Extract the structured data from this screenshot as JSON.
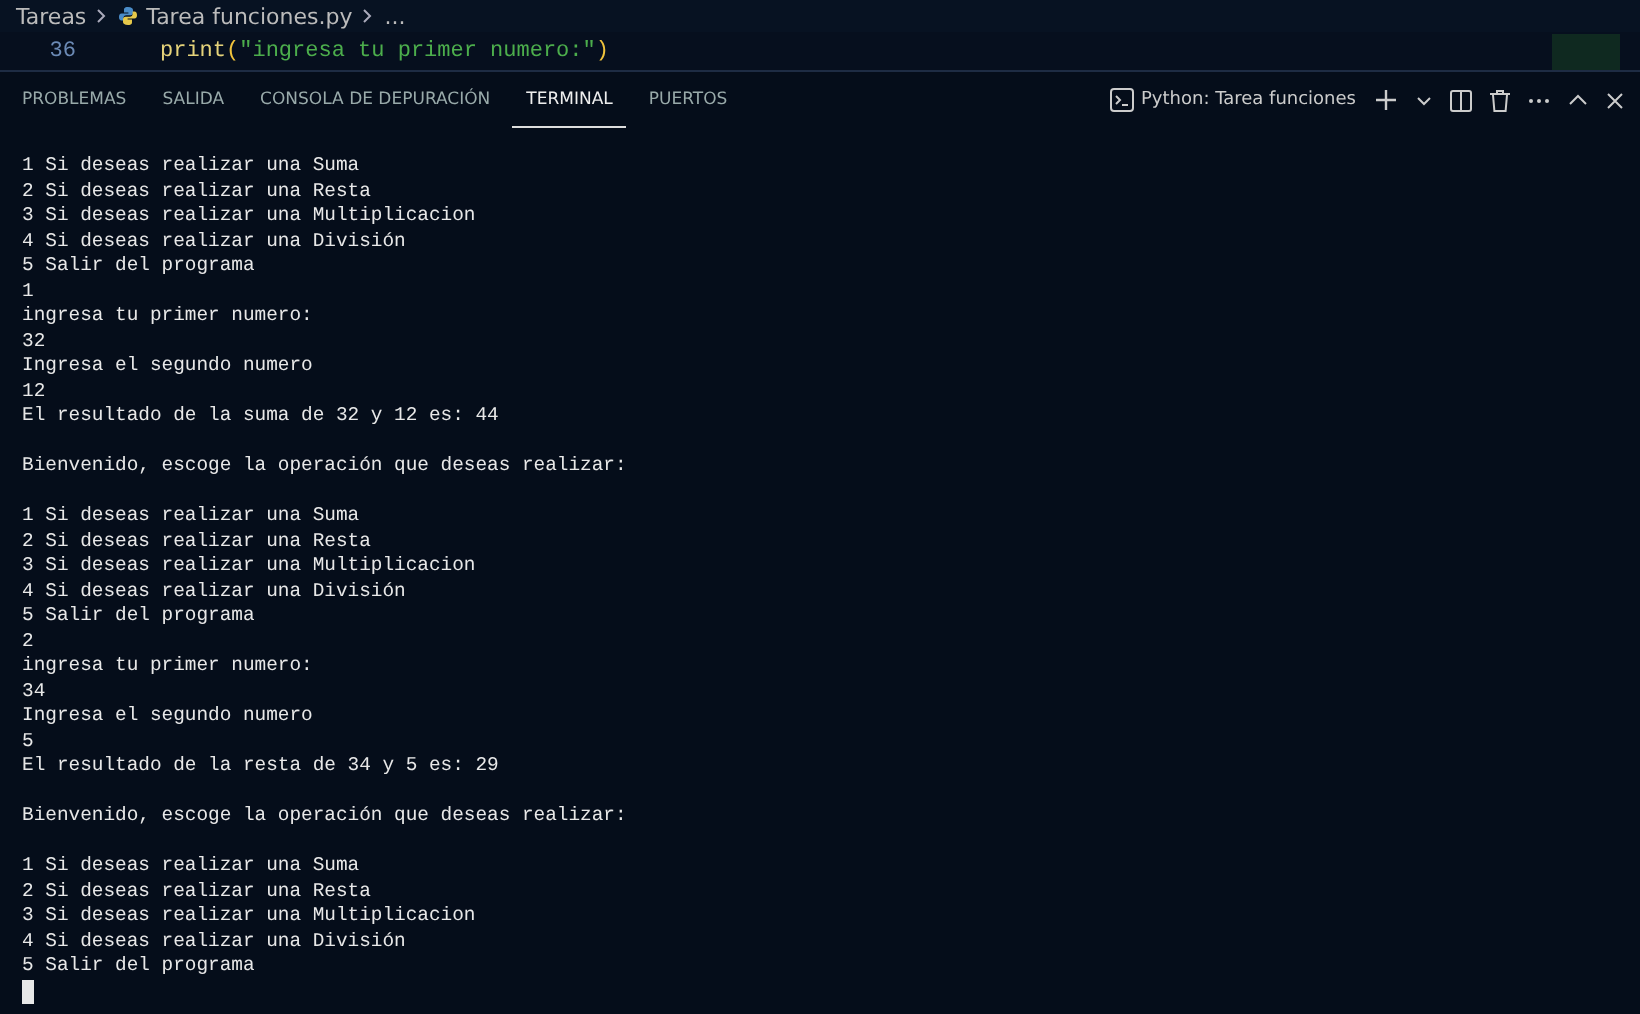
{
  "breadcrumb": {
    "folder": "Tareas",
    "file": "Tarea funciones.py",
    "more": "..."
  },
  "editor": {
    "line_number": "36",
    "code": {
      "func": "print",
      "open": "(",
      "string": "\"ingresa tu primer numero:\"",
      "close": ")"
    }
  },
  "panel_tabs": [
    {
      "label": "PROBLEMAS",
      "selected": false
    },
    {
      "label": "SALIDA",
      "selected": false
    },
    {
      "label": "CONSOLA DE DEPURACIÓN",
      "selected": false
    },
    {
      "label": "TERMINAL",
      "selected": true
    },
    {
      "label": "PUERTOS",
      "selected": false
    }
  ],
  "terminal_picker": {
    "label": "Python: Tarea funciones"
  },
  "terminal_blocks": [
    [
      "1 Si deseas realizar una Suma",
      "2 Si deseas realizar una Resta",
      "3 Si deseas realizar una Multiplicacion",
      "4 Si deseas realizar una División",
      "5 Salir del programa",
      "1",
      "ingresa tu primer numero:",
      "32",
      "Ingresa el segundo numero",
      "12",
      "El resultado de la suma de 32 y 12 es: 44"
    ],
    [
      "Bienvenido, escoge la operación que deseas realizar:"
    ],
    [
      "1 Si deseas realizar una Suma",
      "2 Si deseas realizar una Resta",
      "3 Si deseas realizar una Multiplicacion",
      "4 Si deseas realizar una División",
      "5 Salir del programa",
      "2",
      "ingresa tu primer numero:",
      "34",
      "Ingresa el segundo numero",
      "5",
      "El resultado de la resta de 34 y 5 es: 29"
    ],
    [
      "Bienvenido, escoge la operación que deseas realizar:"
    ],
    [
      "1 Si deseas realizar una Suma",
      "2 Si deseas realizar una Resta",
      "3 Si deseas realizar una Multiplicacion",
      "4 Si deseas realizar una División",
      "5 Salir del programa"
    ]
  ]
}
